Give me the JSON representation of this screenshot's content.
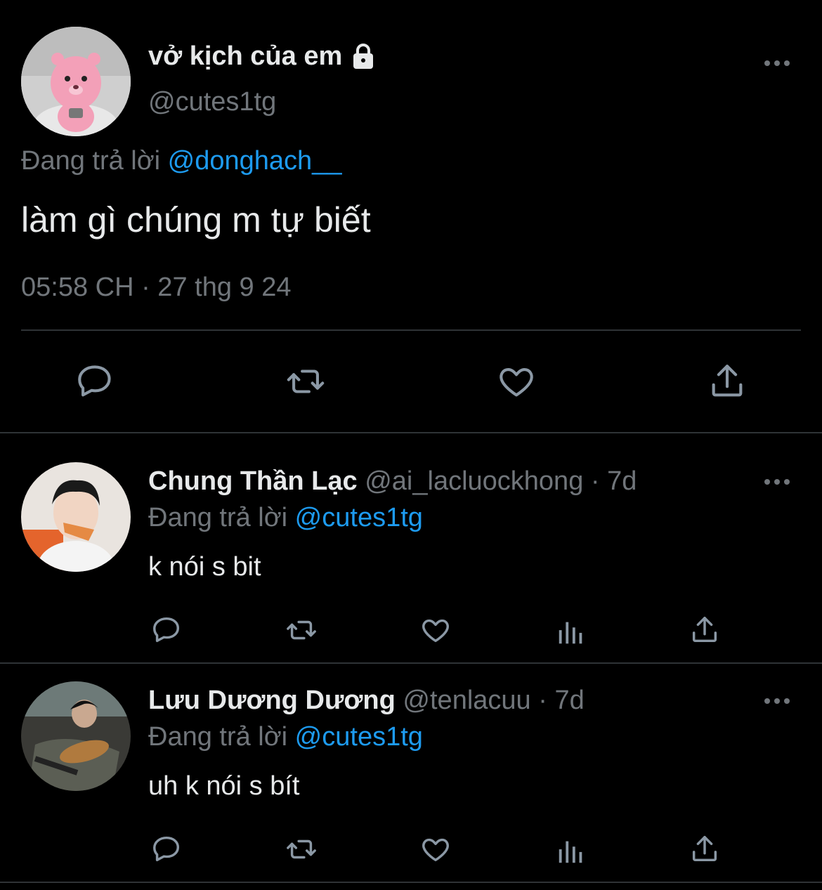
{
  "main_tweet": {
    "display_name": "vở kịch của em",
    "handle": "@cutes1tg",
    "replying_prefix": "Đang trả lời",
    "replying_to": "@donghach__",
    "text": "làm gì chúng m tự biết",
    "timestamp": "05:58 CH · 27 thg 9 24",
    "locked_icon": "lock-icon",
    "actions": [
      "reply-icon",
      "retweet-icon",
      "like-icon",
      "share-icon"
    ]
  },
  "replies": [
    {
      "display_name": "Chung Thần Lạc",
      "handle": "@ai_lacluockhong",
      "age": "· 7d",
      "replying_prefix": "Đang trả lời",
      "replying_to": "@cutes1tg",
      "text": "k nói s bit"
    },
    {
      "display_name": "Lưu Dương Dương",
      "handle": "@tenlacuu",
      "age": "· 7d",
      "replying_prefix": "Đang trả lời",
      "replying_to": "@cutes1tg",
      "text": "uh k nói s bít"
    }
  ],
  "colors": {
    "background": "#000000",
    "text": "#e7e9ea",
    "muted": "#71767b",
    "link": "#1d9bf0",
    "divider": "#2f3336"
  }
}
